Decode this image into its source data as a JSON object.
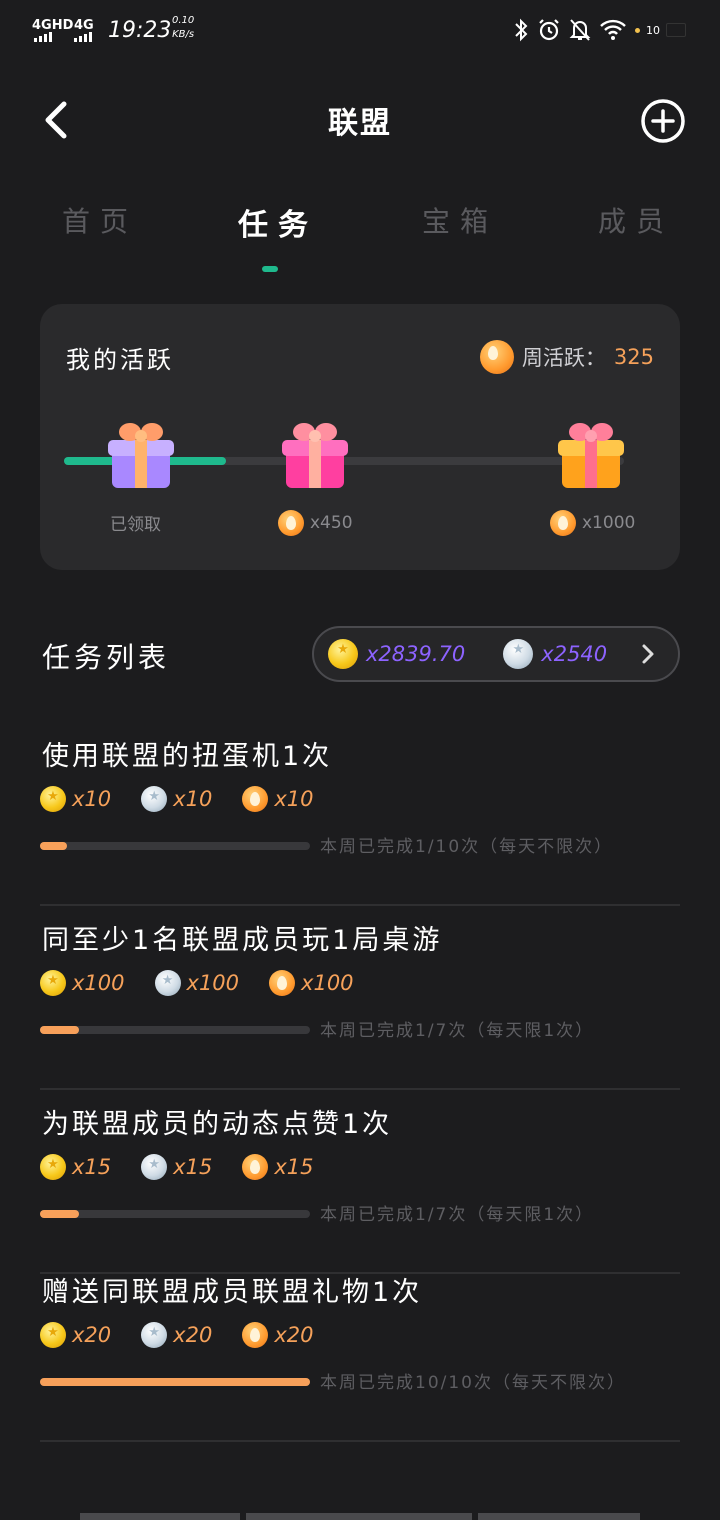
{
  "status_bar": {
    "network1": "4GHD",
    "network2": "4G",
    "time": "19:23",
    "speed_value": "0.10",
    "speed_unit": "KB/s",
    "battery": "10",
    "icons": [
      "bluetooth-icon",
      "alarm-icon",
      "mute-icon",
      "wifi-icon",
      "battery-icon"
    ]
  },
  "header": {
    "title": "联盟",
    "back_icon": "chevron-left-icon",
    "add_icon": "plus-circle-icon"
  },
  "tabs": {
    "items": [
      "首页",
      "任务",
      "宝箱",
      "成员"
    ],
    "active_index": 1
  },
  "activity": {
    "title": "我的活跃",
    "weekly_label": "周活跃：",
    "weekly_value": "325",
    "progress_fraction": 0.29,
    "milestones": [
      {
        "label": "已领取",
        "claimed": true
      },
      {
        "label": "x450",
        "claimed": false
      },
      {
        "label": "x1000",
        "claimed": false
      }
    ]
  },
  "task_list": {
    "title": "任务列表",
    "balance_gold": "x2839.70",
    "balance_silver": "x2540",
    "tasks": [
      {
        "title": "使用联盟的扭蛋机1次",
        "reward_gold": "x10",
        "reward_silver": "x10",
        "reward_fire": "x10",
        "progress_fraction": 0.1,
        "progress_text": "本周已完成1/10次（每天不限次）"
      },
      {
        "title": "同至少1名联盟成员玩1局桌游",
        "reward_gold": "x100",
        "reward_silver": "x100",
        "reward_fire": "x100",
        "progress_fraction": 0.143,
        "progress_text": "本周已完成1/7次（每天限1次）"
      },
      {
        "title": "为联盟成员的动态点赞1次",
        "reward_gold": "x15",
        "reward_silver": "x15",
        "reward_fire": "x15",
        "progress_fraction": 0.143,
        "progress_text": "本周已完成1/7次（每天限1次）"
      },
      {
        "title": "赠送同联盟成员联盟礼物1次",
        "reward_gold": "x20",
        "reward_silver": "x20",
        "reward_fire": "x20",
        "progress_fraction": 1.0,
        "progress_text": "本周已完成10/10次（每天不限次）"
      }
    ]
  },
  "colors": {
    "accent_green": "#1fb98d",
    "orange": "#f5a15a",
    "purple": "#8d63ff",
    "background": "#1c1c1e",
    "card": "#2a2a2c"
  }
}
